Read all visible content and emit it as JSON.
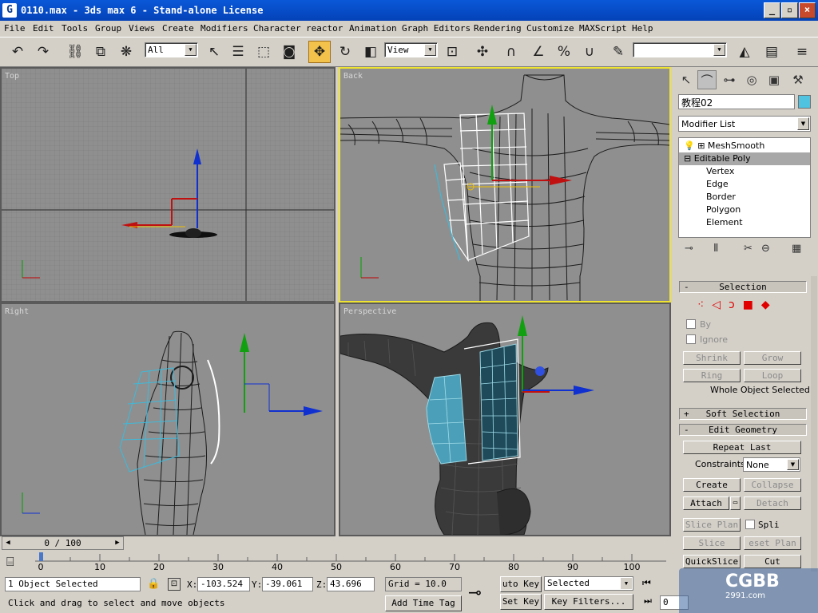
{
  "window": {
    "title": "0110.max - 3ds max 6 - Stand-alone License",
    "app_icon": "G"
  },
  "window_controls": {
    "minimize": "_",
    "maximize": "▫",
    "close": "×"
  },
  "menu": [
    "File",
    "Edit",
    "Tools",
    "Group",
    "Views",
    "Create",
    "Modifiers",
    "Character",
    "reactor",
    "Animation",
    "Graph Editors",
    "Rendering",
    "Customize",
    "MAXScript",
    "Help"
  ],
  "toolbar": {
    "undo_icon": "undo-icon",
    "selection_filter": "All",
    "reference_coord": "View",
    "named_selection": ""
  },
  "viewports": {
    "top": {
      "label": "Top"
    },
    "back": {
      "label": "Back"
    },
    "right": {
      "label": "Right"
    },
    "perspective": {
      "label": "Perspective"
    }
  },
  "command_panel": {
    "object_name": "教程02",
    "object_color": "#4fc3e0",
    "modifier_list": "Modifier List",
    "stack": [
      {
        "label": "MeshSmooth",
        "selected": false
      },
      {
        "label": "Editable Poly",
        "selected": true
      },
      {
        "label": "Vertex",
        "selected": false
      },
      {
        "label": "Edge",
        "selected": false
      },
      {
        "label": "Border",
        "selected": false
      },
      {
        "label": "Polygon",
        "selected": false
      },
      {
        "label": "Element",
        "selected": false
      }
    ],
    "selection_rollout": {
      "title": "Selection",
      "by_label": "By",
      "ignore_label": "Ignore",
      "shrink": "Shrink",
      "grow": "Grow",
      "ring": "Ring",
      "loop": "Loop",
      "status": "Whole Object Selected"
    },
    "soft_selection_title": "Soft Selection",
    "edit_geometry": {
      "title": "Edit Geometry",
      "repeat_last": "Repeat Last",
      "constraints_label": "Constraints:",
      "constraints_value": "None",
      "create": "Create",
      "collapse": "Collapse",
      "attach": "Attach",
      "detach": "Detach",
      "slice_plane": "Slice Plan",
      "split": "Spli",
      "slice": "Slice",
      "reset_plane": "eset Plan",
      "quickslice": "QuickSlice",
      "cut": "Cut"
    }
  },
  "time": {
    "slider": "0 / 100",
    "ticks": [
      "0",
      "10",
      "20",
      "30",
      "40",
      "50",
      "60",
      "70",
      "80",
      "90",
      "100"
    ]
  },
  "status": {
    "selected": "1 Object Selected",
    "prompt": "Click and drag to select and move objects",
    "x_label": "X:",
    "x_value": "-103.524",
    "y_label": "Y:",
    "y_value": "-39.061",
    "z_label": "Z:",
    "z_value": "43.696",
    "grid": "Grid = 10.0",
    "add_time_tag": "Add Time Tag",
    "auto_key": "uto Key",
    "set_key": "Set Key",
    "selected_dropdown": "Selected",
    "key_filters": "Key Filters...",
    "frame": "0"
  },
  "watermark": {
    "text": "CGBB",
    "sub": "2991.com"
  }
}
